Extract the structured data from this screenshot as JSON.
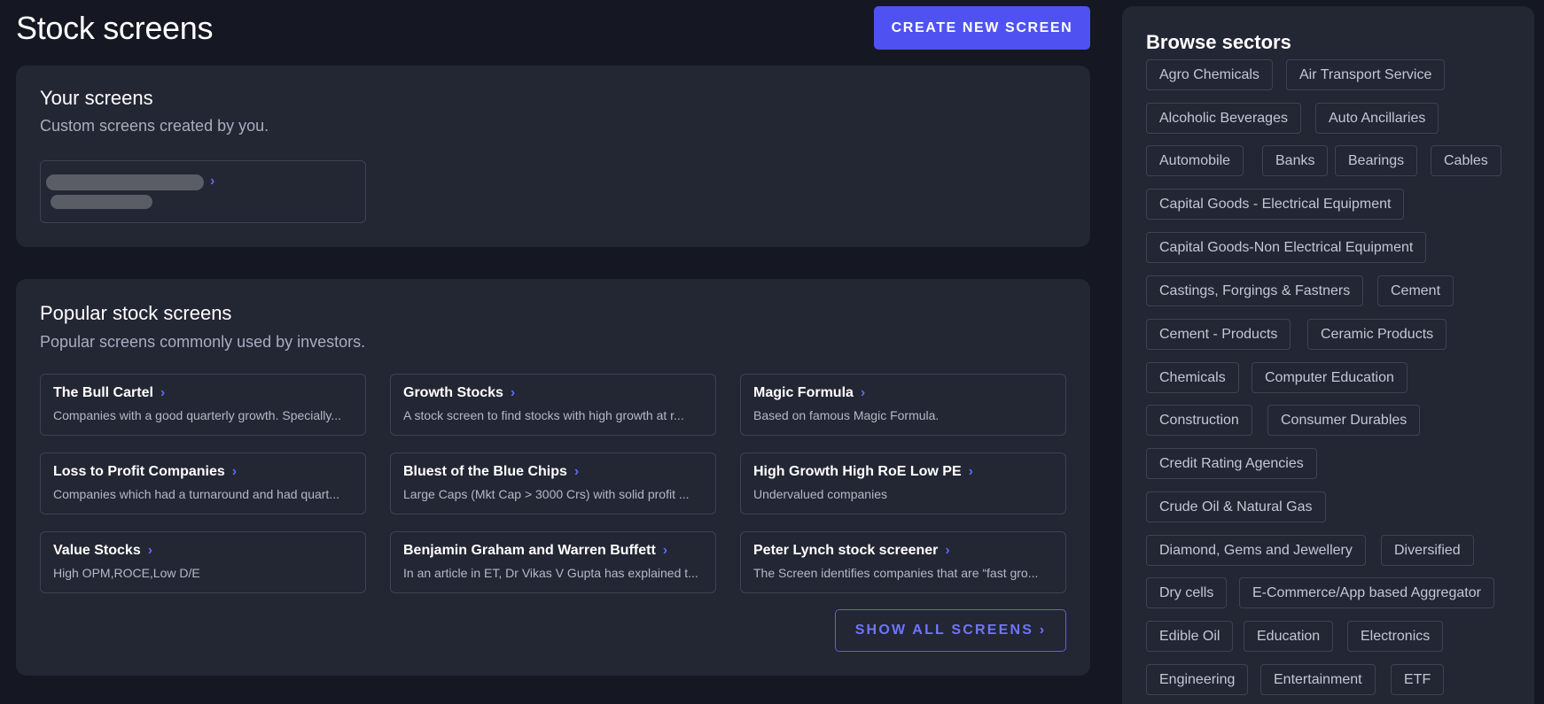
{
  "page_title": "Stock screens",
  "create_button": "CREATE NEW SCREEN",
  "your_screens": {
    "title": "Your screens",
    "subtitle": "Custom screens created by you."
  },
  "popular": {
    "title": "Popular stock screens",
    "subtitle": "Popular screens commonly used by investors.",
    "chevron": "›",
    "items": [
      {
        "name": "The Bull Cartel",
        "desc": "Companies with a good quarterly growth. Specially..."
      },
      {
        "name": "Growth Stocks",
        "desc": "A stock screen to find stocks with high growth at r..."
      },
      {
        "name": "Magic Formula",
        "desc": "Based on famous Magic Formula."
      },
      {
        "name": "Loss to Profit Companies",
        "desc": "Companies which had a turnaround and had quart..."
      },
      {
        "name": "Bluest of the Blue Chips",
        "desc": "Large Caps (Mkt Cap > 3000 Crs) with solid profit ..."
      },
      {
        "name": "High Growth High RoE Low PE",
        "desc": "Undervalued companies"
      },
      {
        "name": "Value Stocks",
        "desc": "High OPM,ROCE,Low D/E"
      },
      {
        "name": "Benjamin Graham and Warren Buffett",
        "desc": "In an article in ET, Dr Vikas V Gupta has explained t..."
      },
      {
        "name": "Peter Lynch stock screener",
        "desc": "The Screen identifies companies that are “fast gro..."
      }
    ],
    "show_all": "SHOW ALL SCREENS  ›"
  },
  "sectors": {
    "title": "Browse sectors",
    "items": [
      "Agro Chemicals",
      "Air Transport Service",
      "Alcoholic Beverages",
      "Auto Ancillaries",
      "Automobile",
      "Banks",
      "Bearings",
      "Cables",
      "Capital Goods - Electrical Equipment",
      "Capital Goods-Non Electrical Equipment",
      "Castings, Forgings & Fastners",
      "Cement",
      "Cement - Products",
      "Ceramic Products",
      "Chemicals",
      "Computer Education",
      "Construction",
      "Consumer Durables",
      "Credit Rating Agencies",
      "Crude Oil & Natural Gas",
      "Diamond, Gems and Jewellery",
      "Diversified",
      "Dry cells",
      "E-Commerce/App based Aggregator",
      "Edible Oil",
      "Education",
      "Electronics",
      "Engineering",
      "Entertainment",
      "ETF"
    ]
  },
  "colors": {
    "background": "#151722",
    "card": "#232633",
    "accent": "#4f52f0",
    "link": "#5a6cf6"
  }
}
